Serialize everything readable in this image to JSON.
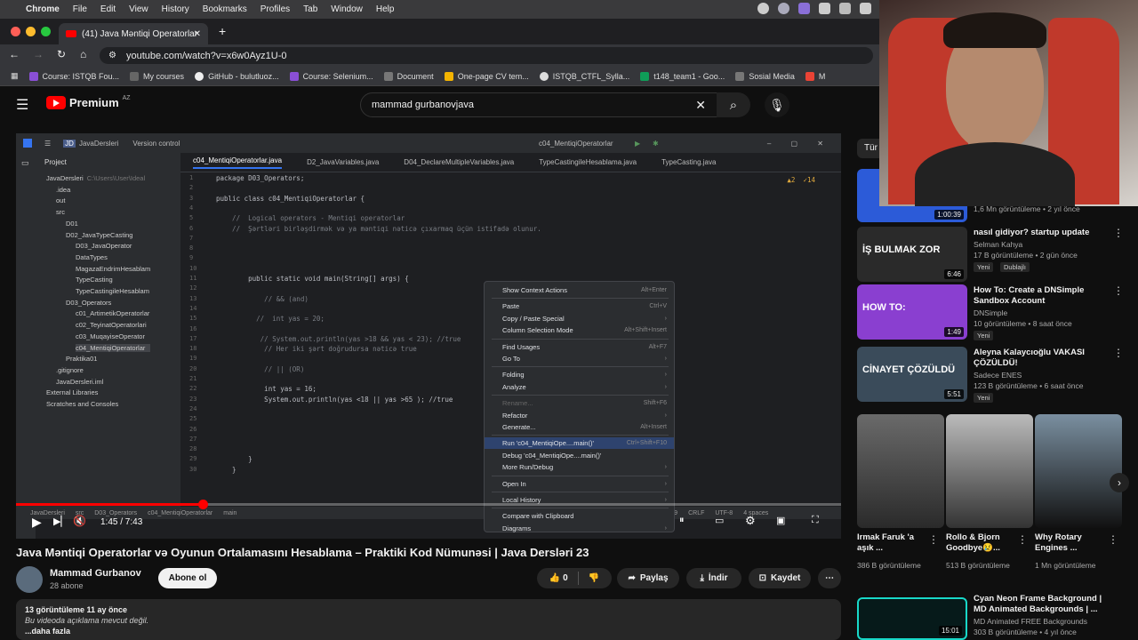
{
  "macmenu": {
    "apple": "",
    "items": [
      "Chrome",
      "File",
      "Edit",
      "View",
      "History",
      "Bookmarks",
      "Profiles",
      "Tab",
      "Window",
      "Help"
    ]
  },
  "browser": {
    "tab_title": "(41) Java Məntiqi Operatorlar",
    "url": "youtube.com/watch?v=x6w0Ayz1U-0",
    "bookmarks": [
      "Course: ISTQB Fou...",
      "My courses",
      "GitHub - bulutluoz...",
      "Course: Selenium...",
      "Document",
      "One-page CV tem...",
      "ISTQB_CTFL_Sylla...",
      "t148_team1 - Goo...",
      "Sosial Media",
      "M"
    ]
  },
  "yt_header": {
    "logo": "Premium",
    "region": "AZ",
    "search_value": "mammad  gurbanovjava"
  },
  "ide": {
    "project_name": "JavaDersleri",
    "version_control": "Version control",
    "run_config": "c04_MentiqiOperatorlar",
    "tabs": [
      "c04_MentiqiOperatorlar.java",
      "D2_JavaVariables.java",
      "D04_DeclareMultipleVariables.java",
      "TypeCastingileHesablama.java",
      "TypeCasting.java"
    ],
    "project_label": "Project",
    "tree": [
      {
        "label": "JavaDersleri",
        "note": "C:\\Users\\User\\Ideal",
        "indent": 0
      },
      {
        "label": ".idea",
        "indent": 1
      },
      {
        "label": "out",
        "indent": 1
      },
      {
        "label": "src",
        "indent": 1
      },
      {
        "label": "D01",
        "indent": 2
      },
      {
        "label": "D02_JavaTypeCasting",
        "indent": 2
      },
      {
        "label": "D03_JavaOperator",
        "indent": 3
      },
      {
        "label": "DataTypes",
        "indent": 3
      },
      {
        "label": "MagazaEndrimHesablam",
        "indent": 3
      },
      {
        "label": "TypeCasting",
        "indent": 3
      },
      {
        "label": "TypeCastingileHesablam",
        "indent": 3
      },
      {
        "label": "D03_Operators",
        "indent": 2
      },
      {
        "label": "c01_ArtimetikOperatorlar",
        "indent": 3
      },
      {
        "label": "c02_TeyinatOperatorlari",
        "indent": 3
      },
      {
        "label": "c03_MuqayiseOperator",
        "indent": 3
      },
      {
        "label": "c04_MentiqiOperatorlar",
        "indent": 3
      },
      {
        "label": "Praktika01",
        "indent": 2
      },
      {
        "label": ".gitignore",
        "indent": 1
      },
      {
        "label": "JavaDersleri.iml",
        "indent": 1
      },
      {
        "label": "External Libraries",
        "indent": 0
      },
      {
        "label": "Scratches and Consoles",
        "indent": 0
      }
    ],
    "code_lines": [
      {
        "n": "1",
        "t": "package D03_Operators;"
      },
      {
        "n": "2",
        "t": ""
      },
      {
        "n": "3",
        "t": "public class c04_MentiqiOperatorlar {"
      },
      {
        "n": "4",
        "t": ""
      },
      {
        "n": "5",
        "t": "    //  Logical operators - Mentiqi operatorlar"
      },
      {
        "n": "6",
        "t": "    //  Şərtləri birləşdirmək və ya məntiqi nəticə çıxarmaq üçün istifadə olunur."
      },
      {
        "n": "7",
        "t": ""
      },
      {
        "n": "8",
        "t": ""
      },
      {
        "n": "9",
        "t": ""
      },
      {
        "n": "10",
        "t": ""
      },
      {
        "n": "11",
        "t": "        public static void main(String[] args) {"
      },
      {
        "n": "12",
        "t": ""
      },
      {
        "n": "13",
        "t": "            // && (and)"
      },
      {
        "n": "14",
        "t": ""
      },
      {
        "n": "15",
        "t": "          //  int yas = 20;"
      },
      {
        "n": "16",
        "t": ""
      },
      {
        "n": "17",
        "t": "           // System.out.println(yas >18 && yas < 23); //true"
      },
      {
        "n": "18",
        "t": "            // Her iki şərt doğrudursa nəticə true"
      },
      {
        "n": "19",
        "t": ""
      },
      {
        "n": "20",
        "t": "            // || (OR)"
      },
      {
        "n": "21",
        "t": ""
      },
      {
        "n": "22",
        "t": "            int yas = 16;"
      },
      {
        "n": "23",
        "t": "            System.out.println(yas <18 || yas >65 ); //true"
      },
      {
        "n": "24",
        "t": ""
      },
      {
        "n": "25",
        "t": ""
      },
      {
        "n": "26",
        "t": ""
      },
      {
        "n": "27",
        "t": ""
      },
      {
        "n": "28",
        "t": ""
      },
      {
        "n": "29",
        "t": "        }"
      },
      {
        "n": "30",
        "t": "    }"
      }
    ],
    "warnings": "▲2  ✓14",
    "breadcrumb": [
      "JavaDersleri",
      "src",
      "D03_Operators",
      "c04_MentiqiOperatorlar",
      "main"
    ],
    "status_right": [
      "24:9",
      "CRLF",
      "UTF-8",
      "4 spaces"
    ],
    "context_menu": [
      {
        "label": "Show Context Actions",
        "shortcut": "Alt+Enter"
      },
      {
        "sep": true
      },
      {
        "label": "Paste",
        "shortcut": "Ctrl+V"
      },
      {
        "label": "Copy / Paste Special",
        "shortcut": "›"
      },
      {
        "label": "Column Selection Mode",
        "shortcut": "Alt+Shift+Insert"
      },
      {
        "sep": true
      },
      {
        "label": "Find Usages",
        "shortcut": "Alt+F7"
      },
      {
        "label": "Go To",
        "shortcut": "›"
      },
      {
        "sep": true
      },
      {
        "label": "Folding",
        "shortcut": "›"
      },
      {
        "label": "Analyze",
        "shortcut": "›"
      },
      {
        "sep": true
      },
      {
        "label": "Rename...",
        "shortcut": "Shift+F6",
        "disabled": true
      },
      {
        "label": "Refactor",
        "shortcut": "›"
      },
      {
        "label": "Generate...",
        "shortcut": "Alt+Insert"
      },
      {
        "sep": true
      },
      {
        "label": "Run 'c04_MentiqiOpe....main()'",
        "shortcut": "Ctrl+Shift+F10",
        "selected": true
      },
      {
        "label": "Debug 'c04_MentiqiOpe....main()'",
        "shortcut": ""
      },
      {
        "label": "More Run/Debug",
        "shortcut": "›"
      },
      {
        "sep": true
      },
      {
        "label": "Open In",
        "shortcut": "›"
      },
      {
        "sep": true
      },
      {
        "label": "Local History",
        "shortcut": "›"
      },
      {
        "sep": true
      },
      {
        "label": "Compare with Clipboard",
        "shortcut": ""
      },
      {
        "label": "Diagrams",
        "shortcut": "›"
      }
    ]
  },
  "player": {
    "time": "1:45 / 7:43",
    "progress": 0.226
  },
  "video": {
    "title": "Java Məntiqi Operatorlar və Oyunun Ortalamasını Hesablama – Praktiki Kod Nümunəsi | Java Dersləri 23",
    "channel": "Mammad Gurbanov",
    "subscribers": "28 abone",
    "subscribe": "Abone ol",
    "likes": "0",
    "share": "Paylaş",
    "download": "İndir",
    "save": "Kaydet",
    "desc_stats": "13 görüntüleme  11 ay önce",
    "desc_text": "Bu videoda açıklama mevcut değil.",
    "desc_more": "...daha fazla"
  },
  "sidebar": {
    "chip": "Tür",
    "top_meta": "1,6 Mn görüntüleme • 2 yıl önce",
    "top_duration": "1:00:39",
    "items": [
      {
        "title": "nasıl gidiyor? startup update",
        "channel": "Selman Kahya",
        "meta": "17 B görüntüleme • 2 gün önce",
        "badges": [
          "Yeni",
          "Dublajlı"
        ],
        "duration": "6:46",
        "thumb": "#2a2a2a",
        "thumbtext": "İŞ BULMAK ZOR"
      },
      {
        "title": "How To: Create a DNSimple Sandbox Account",
        "channel": "DNSimple",
        "meta": "10 görüntüleme • 8 saat önce",
        "badges": [
          "Yeni"
        ],
        "duration": "1:49",
        "thumb": "#8a3fd0",
        "thumbtext": "HOW TO:"
      },
      {
        "title": "Aleyna Kalaycıoğlu VAKASI ÇÖZÜLDÜ!",
        "channel": "Sadece ENES",
        "meta": "123 B görüntüleme • 6 saat önce",
        "badges": [
          "Yeni"
        ],
        "duration": "5:51",
        "thumb": "#3a4b5a",
        "thumbtext": "CİNAYET ÇÖZÜLDÜ"
      }
    ],
    "shorts": [
      {
        "title": "Irmak Faruk 'a aşık ...",
        "views": "386 B görüntüleme"
      },
      {
        "title": "Rollo & Bjorn Goodbye😢...",
        "views": "513 B görüntüleme"
      },
      {
        "title": "Why Rotary Engines ...",
        "views": "1 Mn görüntüleme"
      }
    ],
    "bottom": {
      "title": "Cyan Neon Frame Background | MD Animated Backgrounds | ...",
      "channel": "MD Animated FREE Backgrounds",
      "meta": "303 B görüntüleme • 4 yıl önce",
      "duration": "15:01"
    }
  }
}
